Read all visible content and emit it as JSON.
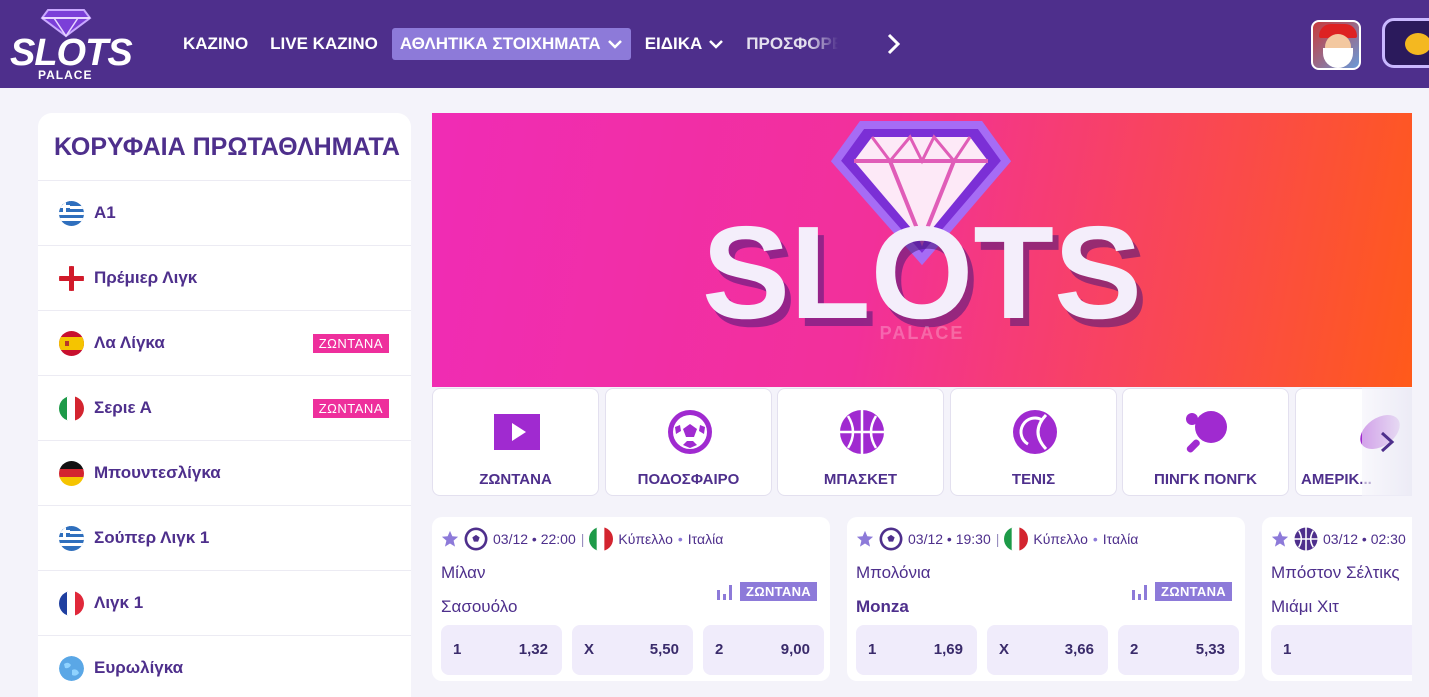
{
  "header": {
    "logo": {
      "word": "SLOTS",
      "sub": "PALACE"
    },
    "nav": [
      {
        "label": "ΚΑΖΙΝΟ",
        "active": false,
        "dropdown": false
      },
      {
        "label": "LIVE ΚΑΖΙΝΟ",
        "active": false,
        "dropdown": false
      },
      {
        "label": "ΑΘΛΗΤΙΚΑ ΣΤΟΙΧΗΜΑΤΑ",
        "active": true,
        "dropdown": true
      },
      {
        "label": "ΕΙΔΙΚΑ",
        "active": false,
        "dropdown": true
      },
      {
        "label": "ΠΡΟΣΦΟΡΕΣ",
        "active": false,
        "dropdown": false
      }
    ],
    "nav_next_icon": "chevron-right-icon"
  },
  "sidebar": {
    "title": "ΚΟΡΥΦΑΙΑ ΠΡΩΤΑΘΛΗΜΑΤΑ",
    "leagues": [
      {
        "name": "Α1",
        "flag": "greece",
        "live": ""
      },
      {
        "name": "Πρέμιερ Λιγκ",
        "flag": "england",
        "live": ""
      },
      {
        "name": "Λα Λίγκα",
        "flag": "spain",
        "live": "ΖΩΝΤΑΝΑ"
      },
      {
        "name": "Σεριε Α",
        "flag": "italy",
        "live": "ΖΩΝΤΑΝΑ"
      },
      {
        "name": "Μπουντεσλίγκα",
        "flag": "germany",
        "live": ""
      },
      {
        "name": "Σούπερ Λιγκ 1",
        "flag": "greece",
        "live": ""
      },
      {
        "name": "Λιγκ 1",
        "flag": "france",
        "live": ""
      },
      {
        "name": "Ευρωλίγκα",
        "flag": "world",
        "live": ""
      }
    ]
  },
  "banner": {
    "word": "SLOTS",
    "sub": "PALACE"
  },
  "sports": [
    {
      "label": "ΖΩΝΤΑΝΑ",
      "icon": "play-icon"
    },
    {
      "label": "ΠΟΔΟΣΦΑΙΡΟ",
      "icon": "soccer-ball-icon"
    },
    {
      "label": "ΜΠΑΣΚΕΤ",
      "icon": "basketball-icon"
    },
    {
      "label": "ΤΕΝΙΣ",
      "icon": "tennis-ball-icon"
    },
    {
      "label": "ΠΙΝΓΚ ΠΟΝΓΚ",
      "icon": "ping-pong-icon"
    },
    {
      "label": "ΑΜΕΡΙΚ...",
      "icon": "american-football-icon"
    }
  ],
  "matches": [
    {
      "datetime": "03/12 • 22:00",
      "competition": "Κύπελλο",
      "country": "Ιταλία",
      "home": "Μίλαν",
      "away": "Σασουόλο",
      "live": "ΖΩΝΤΑΝΑ",
      "odds": [
        {
          "k": "1",
          "v": "1,32"
        },
        {
          "k": "X",
          "v": "5,50"
        },
        {
          "k": "2",
          "v": "9,00"
        }
      ]
    },
    {
      "datetime": "03/12 • 19:30",
      "competition": "Κύπελλο",
      "country": "Ιταλία",
      "home": "Μπολόνια",
      "away": "Monza",
      "live": "ΖΩΝΤΑΝΑ",
      "odds": [
        {
          "k": "1",
          "v": "1,69"
        },
        {
          "k": "X",
          "v": "3,66"
        },
        {
          "k": "2",
          "v": "5,33"
        }
      ]
    },
    {
      "datetime": "03/12 • 02:30",
      "home": "Μπόστον Σέλτικς",
      "away": "Μιάμι Χιτ",
      "odds": [
        {
          "k": "1",
          "v": ""
        }
      ]
    }
  ],
  "colors": {
    "primary": "#4e2f8c",
    "accent": "#8d7ad9",
    "live": "#ee2f9c",
    "icon": "#a02ad0"
  }
}
